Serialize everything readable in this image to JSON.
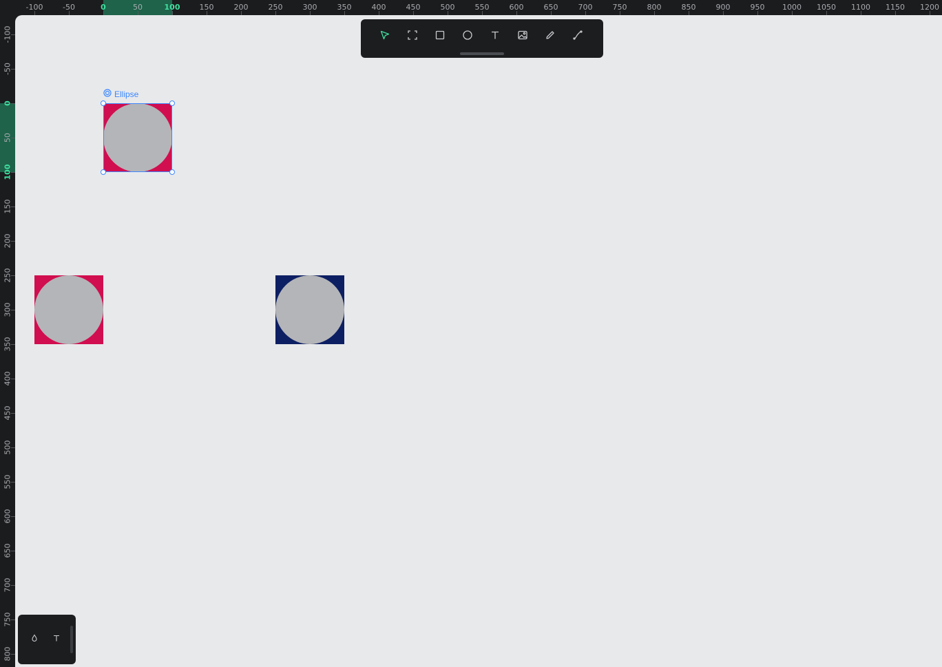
{
  "ruler": {
    "x_ticks": [
      "-100",
      "-50",
      "0",
      "50",
      "100",
      "150",
      "200",
      "250",
      "300",
      "350",
      "400",
      "450",
      "500",
      "550",
      "600",
      "650",
      "700",
      "750",
      "800",
      "850",
      "900",
      "950",
      "1000",
      "1050",
      "1100",
      "1150",
      "1200"
    ],
    "y_ticks": [
      "-100",
      "-50",
      "0",
      "50",
      "100",
      "150",
      "200",
      "250",
      "300",
      "350",
      "400",
      "450",
      "500",
      "550",
      "600",
      "650",
      "700",
      "750",
      "800"
    ],
    "highlight_x": [
      "0",
      "100"
    ],
    "highlight_y": [
      "0",
      "100"
    ],
    "highlight_color": "#3fe0a0"
  },
  "toolbar": {
    "tools": [
      {
        "name": "move-tool",
        "icon": "pointer-arrow-icon",
        "active": true
      },
      {
        "name": "frame-tool",
        "icon": "frame-corners-icon",
        "active": false
      },
      {
        "name": "rectangle-tool",
        "icon": "square-icon",
        "active": false
      },
      {
        "name": "ellipse-tool",
        "icon": "circle-icon",
        "active": false
      },
      {
        "name": "text-tool",
        "icon": "text-t-icon",
        "active": false
      },
      {
        "name": "image-tool",
        "icon": "image-icon",
        "active": false
      },
      {
        "name": "pencil-tool",
        "icon": "pencil-icon",
        "active": false
      },
      {
        "name": "path-tool",
        "icon": "curve-path-icon",
        "active": false
      }
    ]
  },
  "canvas": {
    "background": "#e8e9eb",
    "selection": {
      "label": "Ellipse",
      "color": "#3b86ff",
      "icon": "target-icon"
    },
    "shapes": [
      {
        "name": "selected-ellipse-frame",
        "fill": "#d10e4f",
        "circle_fill": "#b4b5b8"
      },
      {
        "name": "crimson-ellipse-frame",
        "fill": "#d10e4f",
        "circle_fill": "#b4b5b8"
      },
      {
        "name": "navy-ellipse-frame",
        "fill": "#0d1f63",
        "circle_fill": "#b4b5b8"
      }
    ]
  },
  "mini_toolbar": {
    "tools": [
      {
        "name": "fill-tool",
        "icon": "droplet-icon"
      },
      {
        "name": "text-style-tool",
        "icon": "text-t-icon"
      }
    ]
  }
}
